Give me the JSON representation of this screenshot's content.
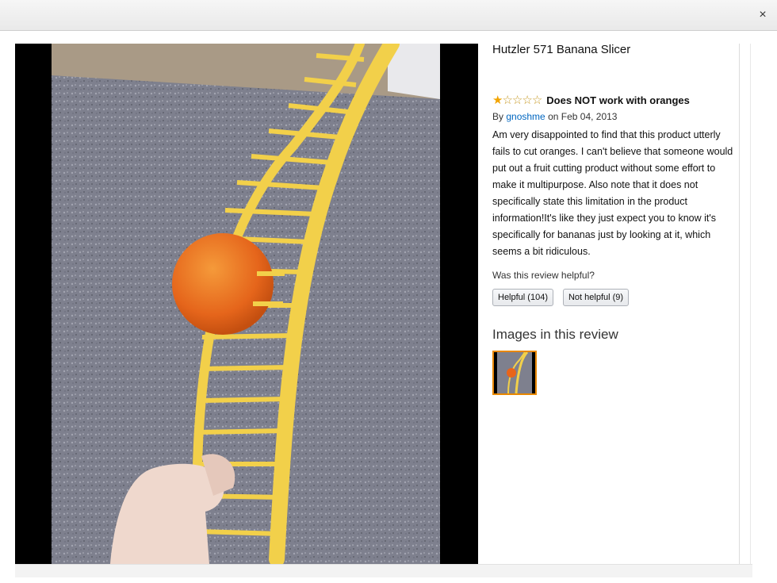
{
  "window": {
    "close_label": "×"
  },
  "product": {
    "title": "Hutzler 571 Banana Slicer"
  },
  "review": {
    "rating": 1,
    "max_rating": 5,
    "title": "Does NOT work with oranges",
    "by_prefix": "By",
    "author": "gnoshme",
    "date_text": "on Feb 04, 2013",
    "body": "Am very disappointed to find that this product utterly fails to cut oranges. I can't believe that someone would put out a fruit cutting product without some effort to make it multipurpose. Also note that it does not specifically state this limitation in the product information!It's like they just expect you to know it's specifically for bananas just by looking at it, which seems a bit ridiculous.",
    "helpful_question": "Was this review helpful?",
    "helpful_label": "Helpful (104)",
    "not_helpful_label": "Not helpful (9)"
  },
  "images_section": {
    "heading": "Images in this review",
    "count": 1
  },
  "colors": {
    "slicer": "#f2d04a",
    "orange": "#e8641a",
    "counter": "#7f8290",
    "accent_link": "#0066c0",
    "thumb_border": "#e98800"
  }
}
